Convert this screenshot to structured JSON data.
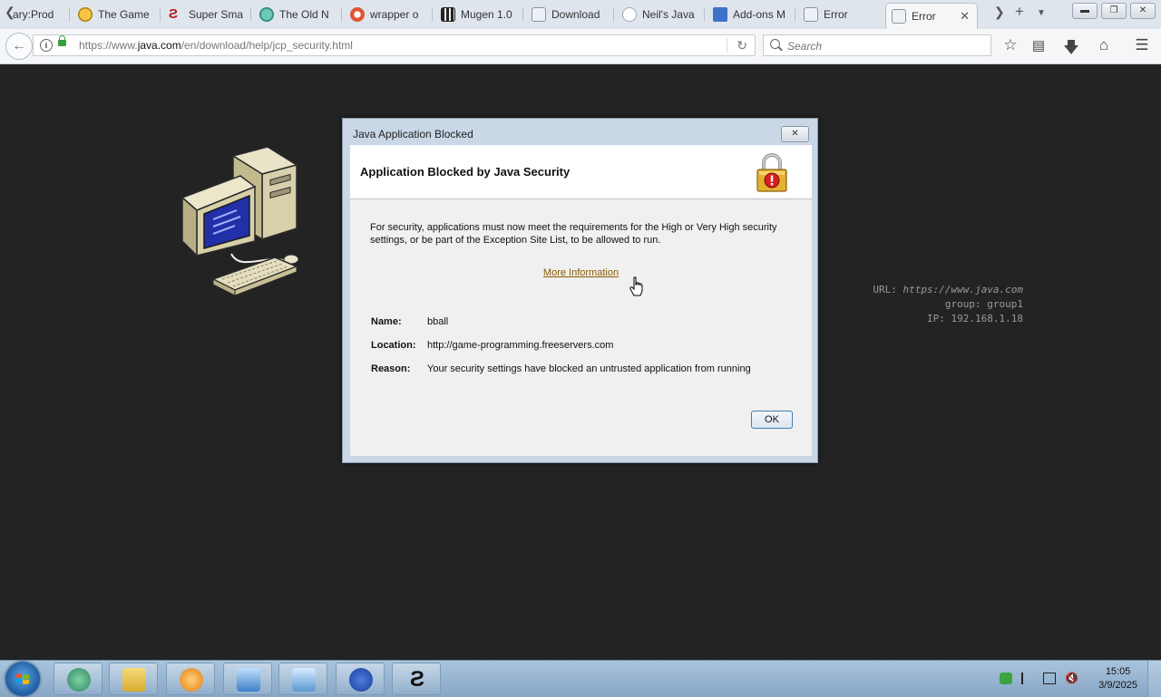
{
  "browser": {
    "tabs": [
      {
        "label": "ary:Prod",
        "icon": "wiki-icon"
      },
      {
        "label": "The Game",
        "icon": "smiley-icon"
      },
      {
        "label": "Super Sma",
        "icon": "s-logo-icon"
      },
      {
        "label": "The Old N",
        "icon": "globe-icon"
      },
      {
        "label": "wrapper o",
        "icon": "duckduckgo-icon"
      },
      {
        "label": "Mugen 1.0",
        "icon": "mugen-icon"
      },
      {
        "label": "Download",
        "icon": "java-icon"
      },
      {
        "label": "Neil's Java",
        "icon": "speech-bubble-icon"
      },
      {
        "label": "Add-ons M",
        "icon": "puzzle-icon"
      },
      {
        "label": "Error",
        "icon": "java-icon"
      },
      {
        "label": "Error",
        "icon": "java-icon",
        "active": true
      }
    ],
    "url": {
      "prefix": "https://www.",
      "domain": "java.com",
      "path": "/en/download/help/jcp_security.html"
    },
    "search_placeholder": "Search"
  },
  "page": {
    "info": {
      "url_label": "URL:",
      "url_value": "https://www.java.com",
      "group_label": "group:",
      "group_value": "group1",
      "ip_label": "IP:",
      "ip_value": "192.168.1.18"
    }
  },
  "dialog": {
    "window_title": "Java Application Blocked",
    "heading": "Application Blocked by Java Security",
    "message": "For security, applications must now meet the requirements for the High or Very High security settings, or be part of the Exception Site List, to be allowed to run.",
    "more_info_label": "More Information",
    "fields": [
      {
        "label": "Name:",
        "value": "bball"
      },
      {
        "label": "Location:",
        "value": "http://game-programming.freeservers.com"
      },
      {
        "label": "Reason:",
        "value": "Your security settings have blocked an untrusted application from running"
      }
    ],
    "ok_label": "OK"
  },
  "taskbar": {
    "apps": [
      "s-logo-icon",
      "file-explorer-icon",
      "media-player-icon",
      "picture-viewer-icon",
      "control-panel-icon",
      "gamefaqs-icon",
      "s-logo-icon"
    ],
    "clock_time": "15:05",
    "clock_date": "3/9/2025"
  },
  "colors": {
    "page_background": "#232323",
    "dialog_body": "#f0f0f0",
    "dialog_frame": "#c9d7e6",
    "link": "#8a5a00",
    "taskbar": "#9bb7d3"
  }
}
